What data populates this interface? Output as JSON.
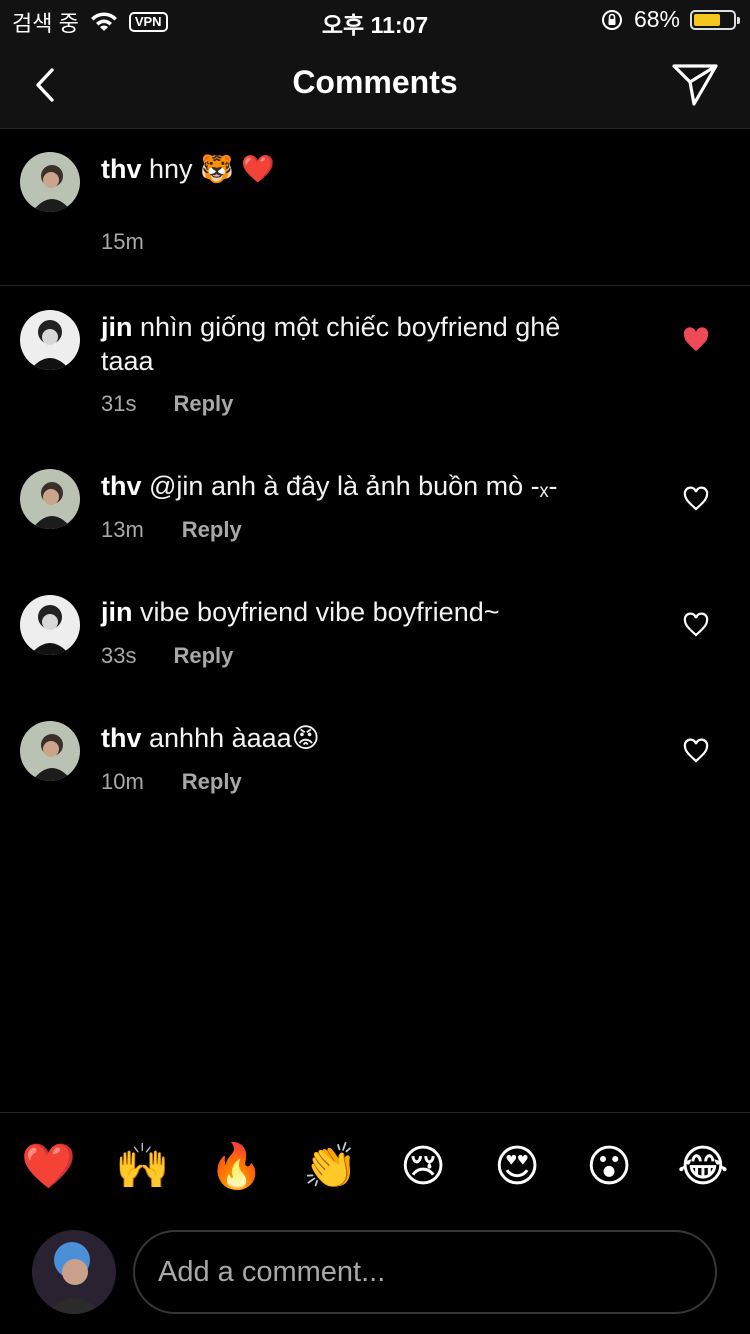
{
  "status_bar": {
    "carrier": "검색 중",
    "vpn": "VPN",
    "time": "오후 11:07",
    "battery": "68%",
    "battery_level": 0.68
  },
  "header": {
    "title": "Comments"
  },
  "caption": {
    "username": "thv",
    "text": "hny 🐯 ❤️",
    "time": "15m"
  },
  "comments": [
    {
      "username": "jin",
      "text": "nhìn giống một chiếc boyfriend ghê taaa",
      "time": "31s",
      "reply": "Reply",
      "liked": true
    },
    {
      "username": "thv",
      "text": "@jin anh à đây là ảnh buồn mò -ₓ-",
      "time": "13m",
      "reply": "Reply",
      "liked": false
    },
    {
      "username": "jin",
      "text": "vibe boyfriend vibe boyfriend~",
      "time": "33s",
      "reply": "Reply",
      "liked": false
    },
    {
      "username": "thv",
      "text": "anhhh àaaa😡",
      "time": "10m",
      "reply": "Reply",
      "liked": false
    }
  ],
  "reactions": [
    "❤️",
    "🙌",
    "🔥",
    "👏",
    "😢",
    "😍",
    "😮",
    "😂"
  ],
  "composer": {
    "placeholder": "Add a comment..."
  },
  "colors": {
    "background": "#000000",
    "like_red": "#ed4956",
    "meta_gray": "#a8a8a8"
  }
}
